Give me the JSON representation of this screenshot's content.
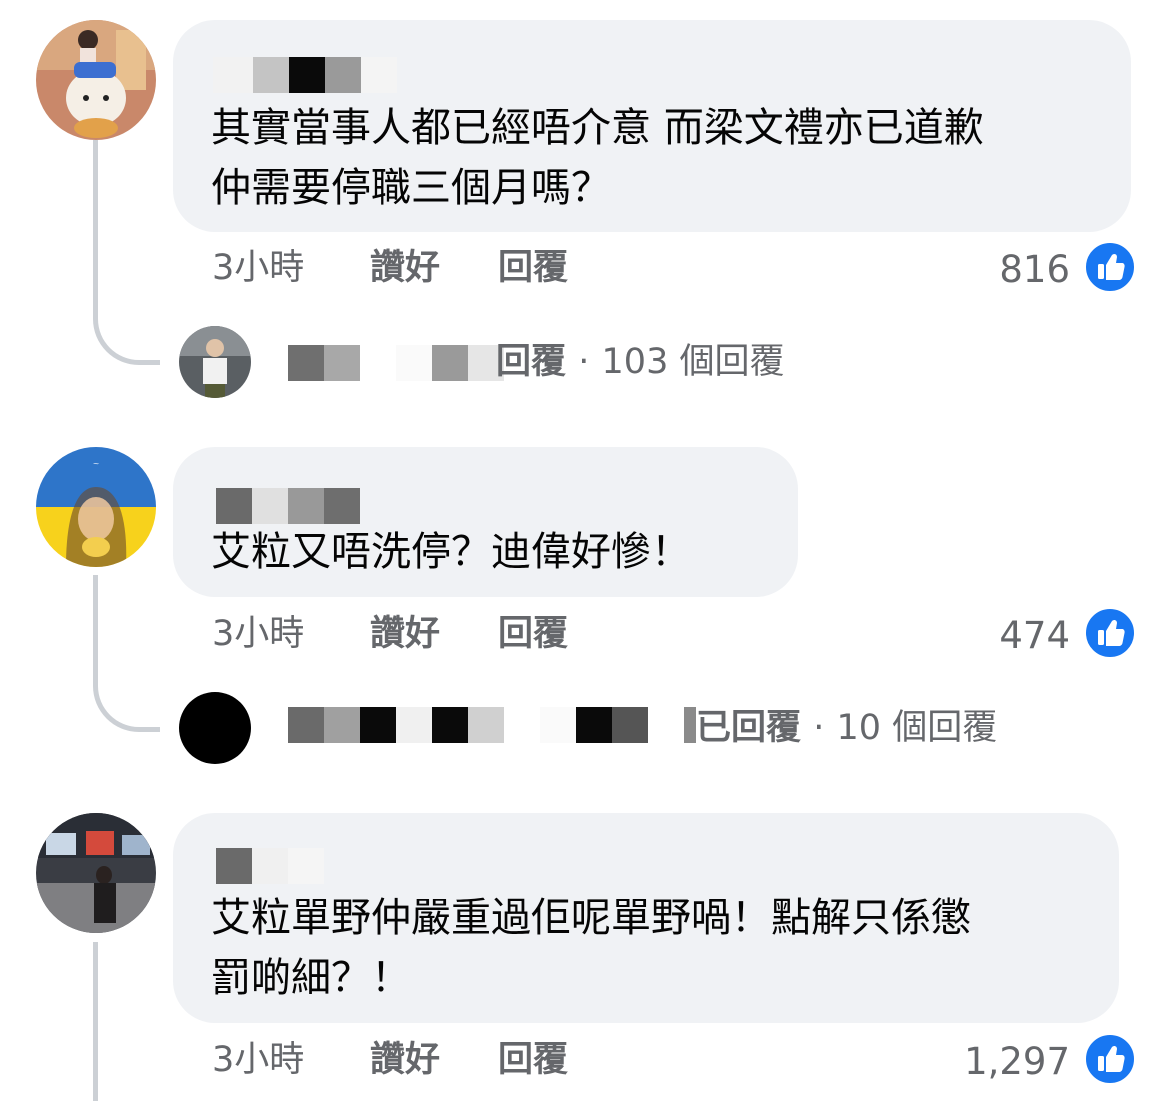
{
  "colors": {
    "bubble": "#f0f2f5",
    "meta_text": "#65676b",
    "like_blue": "#1877f2",
    "thread_line": "#ccd0d5"
  },
  "comments": [
    {
      "text_lines": [
        "其實當事人都已經唔介意 而梁文禮亦已道歉",
        "仲需要停職三個月嗎？"
      ],
      "time": "3小時",
      "like_label": "讚好",
      "reply_label": "回覆",
      "like_count": "816",
      "replies": {
        "prefix": "回覆",
        "sep": "·",
        "count_text": "103 個回覆"
      }
    },
    {
      "text_lines": [
        "艾粒又唔洗停？迪偉好慘！"
      ],
      "time": "3小時",
      "like_label": "讚好",
      "reply_label": "回覆",
      "like_count": "474",
      "replies": {
        "prefix": "已回覆",
        "sep": "·",
        "count_text": "10 個回覆"
      }
    },
    {
      "text_lines": [
        "艾粒單野仲嚴重過佢呢單野喎！點解只係懲",
        "罰啲細？！"
      ],
      "time": "3小時",
      "like_label": "讚好",
      "reply_label": "回覆",
      "like_count": "1,297"
    }
  ],
  "icons": {
    "like": "thumbs-up-icon"
  }
}
